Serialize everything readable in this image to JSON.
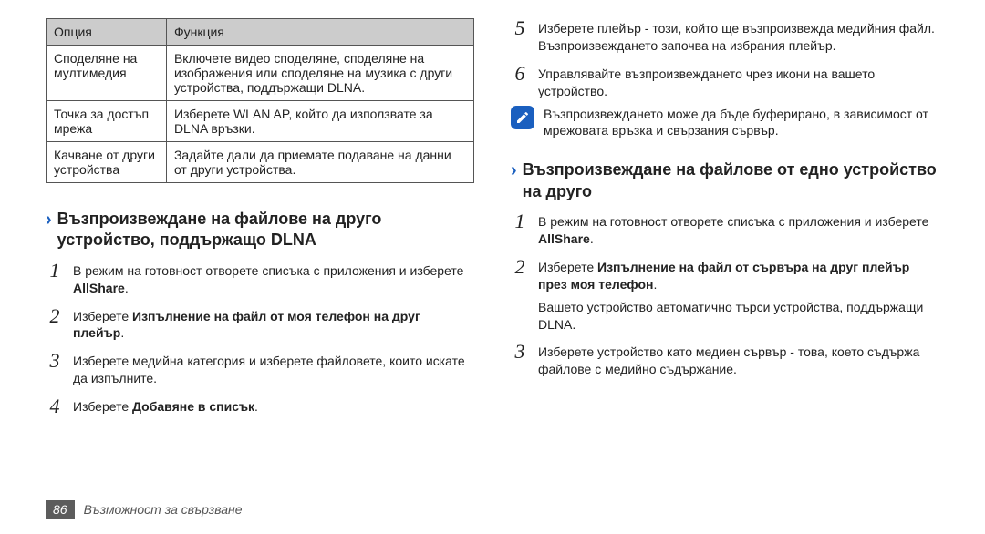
{
  "table": {
    "headers": {
      "option": "Опция",
      "function": "Функция"
    },
    "rows": [
      {
        "option": "Споделяне на мултимедия",
        "function": "Включете видео споделяне, споделяне на изображения или споделяне на музика с други устройства, поддържащи DLNA."
      },
      {
        "option": "Точка за достъп мрежа",
        "function": "Изберете WLAN AP, който да използвате за DLNA връзки."
      },
      {
        "option": "Качване от други устройства",
        "function": "Задайте дали да приемате подаване на данни от други устройства."
      }
    ]
  },
  "left": {
    "section_title": "Възпроизвеждане на файлове на друго устройство, поддържащо DLNA",
    "steps": [
      {
        "n": "1",
        "pre": "В режим на готовност отворете списъка с приложения и изберете ",
        "bold": "AllShare",
        "post": "."
      },
      {
        "n": "2",
        "pre": "Изберете ",
        "bold": "Изпълнение на файл от моя телефон на друг плейър",
        "post": "."
      },
      {
        "n": "3",
        "pre": "Изберете медийна категория и изберете файловете, които искате да изпълните.",
        "bold": "",
        "post": ""
      },
      {
        "n": "4",
        "pre": "Изберете ",
        "bold": "Добавяне в списък",
        "post": "."
      }
    ]
  },
  "right": {
    "steps_top": [
      {
        "n": "5",
        "pre": "Изберете плейър - този, който ще възпроизвежда медийния файл. Възпроизвеждането започва на избрания плейър.",
        "bold": "",
        "post": ""
      },
      {
        "n": "6",
        "pre": "Управлявайте възпроизвеждането чрез икони на вашето устройство.",
        "bold": "",
        "post": ""
      }
    ],
    "note_text": "Възпроизвеждането може да бъде буферирано, в зависимост от мрежовата връзка и свързания сървър.",
    "section_title": "Възпроизвеждане на файлове от едно устройство на друго",
    "steps_bottom": [
      {
        "n": "1",
        "pre": "В режим на готовност отворете списъка с приложения и изберете ",
        "bold": "AllShare",
        "post": "."
      },
      {
        "n": "2",
        "pre": "Изберете ",
        "bold": "Изпълнение на файл от сървъра на друг плейър през моя телефон",
        "post": ".",
        "extra": "Вашето устройство автоматично търси устройства, поддържащи DLNA."
      },
      {
        "n": "3",
        "pre": "Изберете устройство като медиен сървър - това, което съдържа файлове с медийно съдържание.",
        "bold": "",
        "post": ""
      }
    ]
  },
  "footer": {
    "page": "86",
    "title": "Възможност за свързване"
  }
}
